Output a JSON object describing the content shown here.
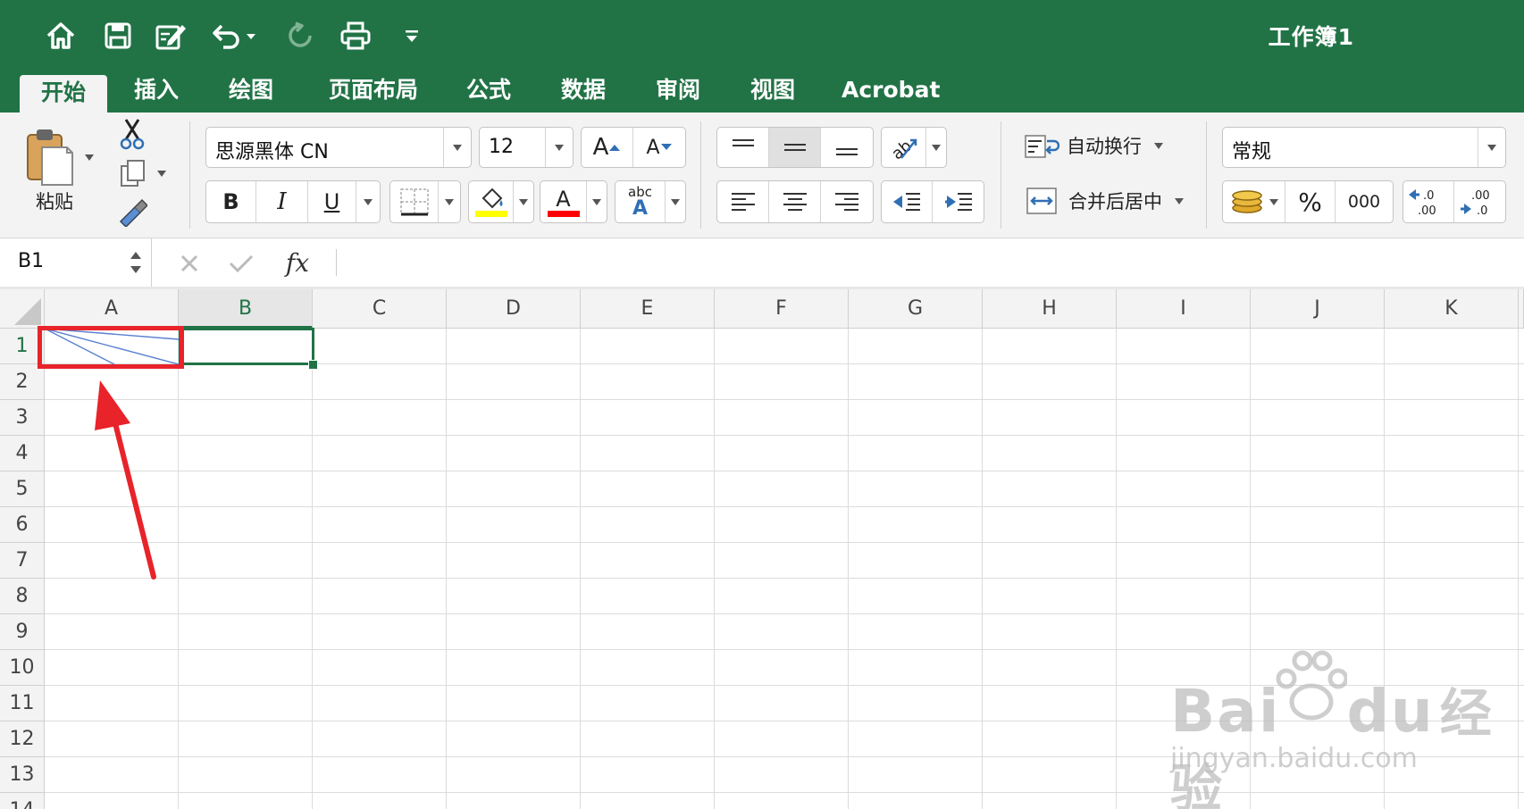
{
  "window": {
    "title": "工作簿1"
  },
  "tabs": [
    {
      "label": "开始",
      "active": true
    },
    {
      "label": "插入"
    },
    {
      "label": "绘图"
    },
    {
      "label": "页面布局"
    },
    {
      "label": "公式"
    },
    {
      "label": "数据"
    },
    {
      "label": "审阅"
    },
    {
      "label": "视图"
    },
    {
      "label": "Acrobat"
    }
  ],
  "ribbon": {
    "paste_label": "粘贴",
    "font_name": "思源黑体 CN",
    "font_size": "12",
    "bold": "B",
    "italic": "I",
    "underline": "U",
    "font_color_glyph": "A",
    "abc_glyph": "abc",
    "wrap_text_label": "自动换行",
    "merge_center_label": "合并后居中",
    "number_format": "常规",
    "percent": "%",
    "thousands": "000",
    "dec_increase_top": ".0",
    "dec_increase_bottom": ".00",
    "dec_decrease_top": ".00",
    "dec_decrease_bottom": ".0",
    "accent_color": "#217346",
    "fill_color": "#ffff00",
    "font_color": "#ff0000"
  },
  "formula_bar": {
    "name_box": "B1",
    "fx": "fx",
    "formula": ""
  },
  "sheet": {
    "columns": [
      "A",
      "B",
      "C",
      "D",
      "E",
      "F",
      "G",
      "H",
      "I",
      "J",
      "K"
    ],
    "rows": [
      "1",
      "2",
      "3",
      "4",
      "5",
      "6",
      "7",
      "8",
      "9",
      "10",
      "11",
      "12",
      "13",
      "14"
    ],
    "selected_cell": "B1",
    "selected_col": "B",
    "selected_row": "1"
  },
  "annotation": {
    "highlight_color": "#e8232a"
  },
  "watermark": {
    "brand": "Bai",
    "brand2": "du",
    "suffix": "经验",
    "url": "jingyan.baidu.com"
  }
}
